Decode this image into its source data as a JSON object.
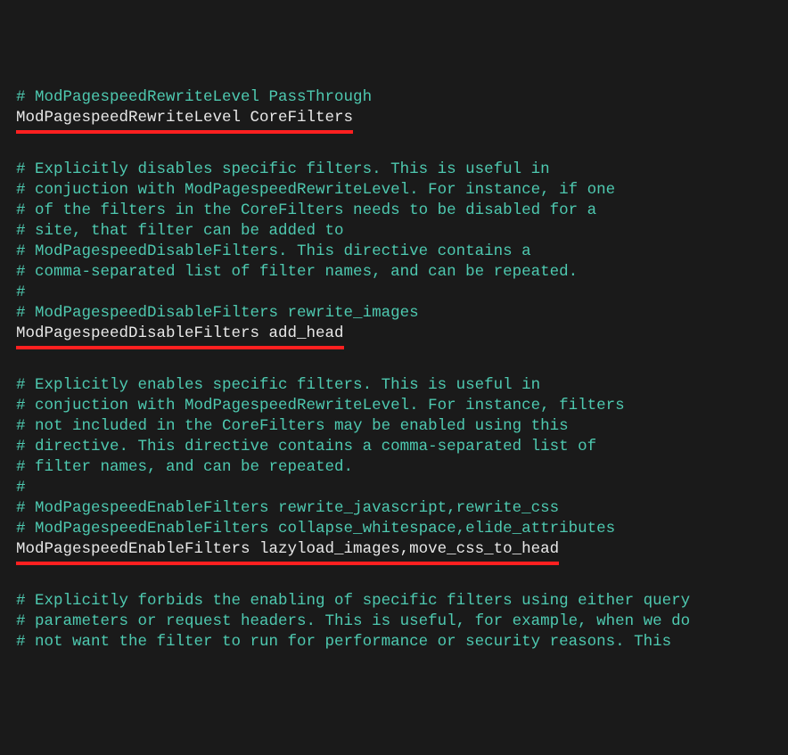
{
  "lines": [
    {
      "type": "comment",
      "text": "# ModPagespeedRewriteLevel PassThrough"
    },
    {
      "type": "directive",
      "text": "ModPagespeedRewriteLevel CoreFilters",
      "underline": true
    },
    {
      "type": "blank",
      "text": ""
    },
    {
      "type": "comment",
      "text": "# Explicitly disables specific filters. This is useful in"
    },
    {
      "type": "comment",
      "text": "# conjuction with ModPagespeedRewriteLevel. For instance, if one"
    },
    {
      "type": "comment",
      "text": "# of the filters in the CoreFilters needs to be disabled for a"
    },
    {
      "type": "comment",
      "text": "# site, that filter can be added to"
    },
    {
      "type": "comment",
      "text": "# ModPagespeedDisableFilters. This directive contains a"
    },
    {
      "type": "comment",
      "text": "# comma-separated list of filter names, and can be repeated."
    },
    {
      "type": "comment",
      "text": "#"
    },
    {
      "type": "comment",
      "text": "# ModPagespeedDisableFilters rewrite_images"
    },
    {
      "type": "directive",
      "text": "ModPagespeedDisableFilters add_head",
      "underline": true
    },
    {
      "type": "blank",
      "text": ""
    },
    {
      "type": "comment",
      "text": "# Explicitly enables specific filters. This is useful in"
    },
    {
      "type": "comment",
      "text": "# conjuction with ModPagespeedRewriteLevel. For instance, filters"
    },
    {
      "type": "comment",
      "text": "# not included in the CoreFilters may be enabled using this"
    },
    {
      "type": "comment",
      "text": "# directive. This directive contains a comma-separated list of"
    },
    {
      "type": "comment",
      "text": "# filter names, and can be repeated."
    },
    {
      "type": "comment",
      "text": "#"
    },
    {
      "type": "comment",
      "text": "# ModPagespeedEnableFilters rewrite_javascript,rewrite_css"
    },
    {
      "type": "comment",
      "text": "# ModPagespeedEnableFilters collapse_whitespace,elide_attributes"
    },
    {
      "type": "directive",
      "text": "ModPagespeedEnableFilters lazyload_images,move_css_to_head",
      "underline": true
    },
    {
      "type": "blank",
      "text": ""
    },
    {
      "type": "comment",
      "text": "# Explicitly forbids the enabling of specific filters using either query"
    },
    {
      "type": "comment",
      "text": "# parameters or request headers. This is useful, for example, when we do"
    },
    {
      "type": "comment",
      "text": "# not want the filter to run for performance or security reasons. This"
    }
  ]
}
